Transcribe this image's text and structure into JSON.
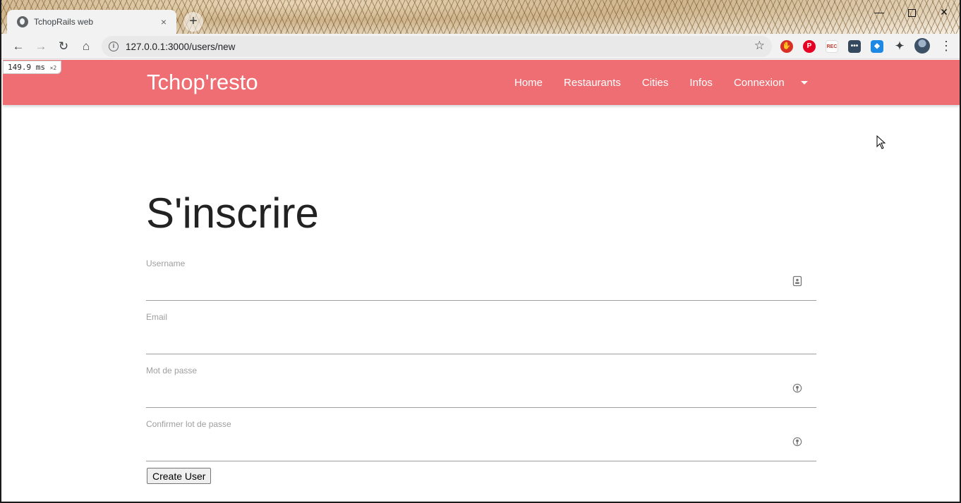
{
  "browser": {
    "tab_title": "TchopRails web",
    "tab_close": "×",
    "new_tab": "+",
    "url": "127.0.0.1:3000/users/new",
    "perf_value": "149.9 ms",
    "perf_multiplier": "×2",
    "extensions": [
      "adblock-icon",
      "pinterest-icon",
      "recorder-icon",
      "dots-extension-icon",
      "shield-extension-icon",
      "puzzle-icon"
    ]
  },
  "navbar": {
    "brand": "Tchop'resto",
    "links": [
      "Home",
      "Restaurants",
      "Cities",
      "Infos",
      "Connexion"
    ],
    "color": "#ee6e73"
  },
  "form": {
    "title": "S'inscrire",
    "username_label": "Username",
    "email_label": "Email",
    "password_label": "Mot de passe",
    "confirm_label": "Confirmer lot de passe",
    "submit": "Create User"
  }
}
